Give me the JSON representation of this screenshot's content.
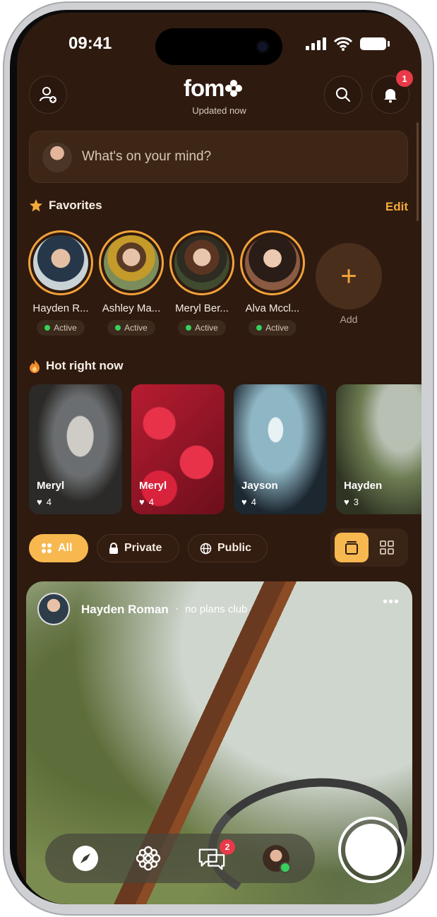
{
  "status": {
    "time": "09:41"
  },
  "header": {
    "logo": "fom",
    "subtitle": "Updated now",
    "notification_count": "1"
  },
  "composer": {
    "placeholder": "What's on your mind?"
  },
  "favorites": {
    "title": "Favorites",
    "edit_label": "Edit",
    "people": [
      {
        "name": "Hayden R...",
        "status": "Active",
        "colors": [
          "#c9d3d6",
          "#27374a"
        ]
      },
      {
        "name": "Ashley Ma...",
        "status": "Active",
        "colors": [
          "#7b8d5a",
          "#c49a2a"
        ]
      },
      {
        "name": "Meryl Ber...",
        "status": "Active",
        "colors": [
          "#3f4a2e",
          "#6a3a25"
        ]
      },
      {
        "name": "Alva Mccl...",
        "status": "Active",
        "colors": [
          "#3a2a22",
          "#8a5a42"
        ]
      }
    ],
    "add_label": "Add"
  },
  "hot": {
    "title": "Hot right now",
    "cards": [
      {
        "name": "Meryl",
        "likes": "4",
        "colors": [
          "#6b6e70",
          "#2c2a28"
        ]
      },
      {
        "name": "Meryl",
        "likes": "4",
        "colors": [
          "#d1243b",
          "#6b0f1b"
        ]
      },
      {
        "name": "Jayson",
        "likes": "4",
        "colors": [
          "#8fb6c4",
          "#1c2730"
        ]
      },
      {
        "name": "Hayden",
        "likes": "3",
        "colors": [
          "#6d7c52",
          "#2e3322"
        ]
      }
    ]
  },
  "filters": {
    "all": "All",
    "private": "Private",
    "public": "Public"
  },
  "post": {
    "author": "Hayden Roman",
    "separator": "·",
    "group": "no plans club",
    "more": "•••"
  },
  "tabbar": {
    "messages_badge": "2"
  },
  "colors": {
    "accent": "#f7b84f",
    "background": "#2e1a0f",
    "badge": "#e83a49",
    "online": "#37d05c"
  }
}
